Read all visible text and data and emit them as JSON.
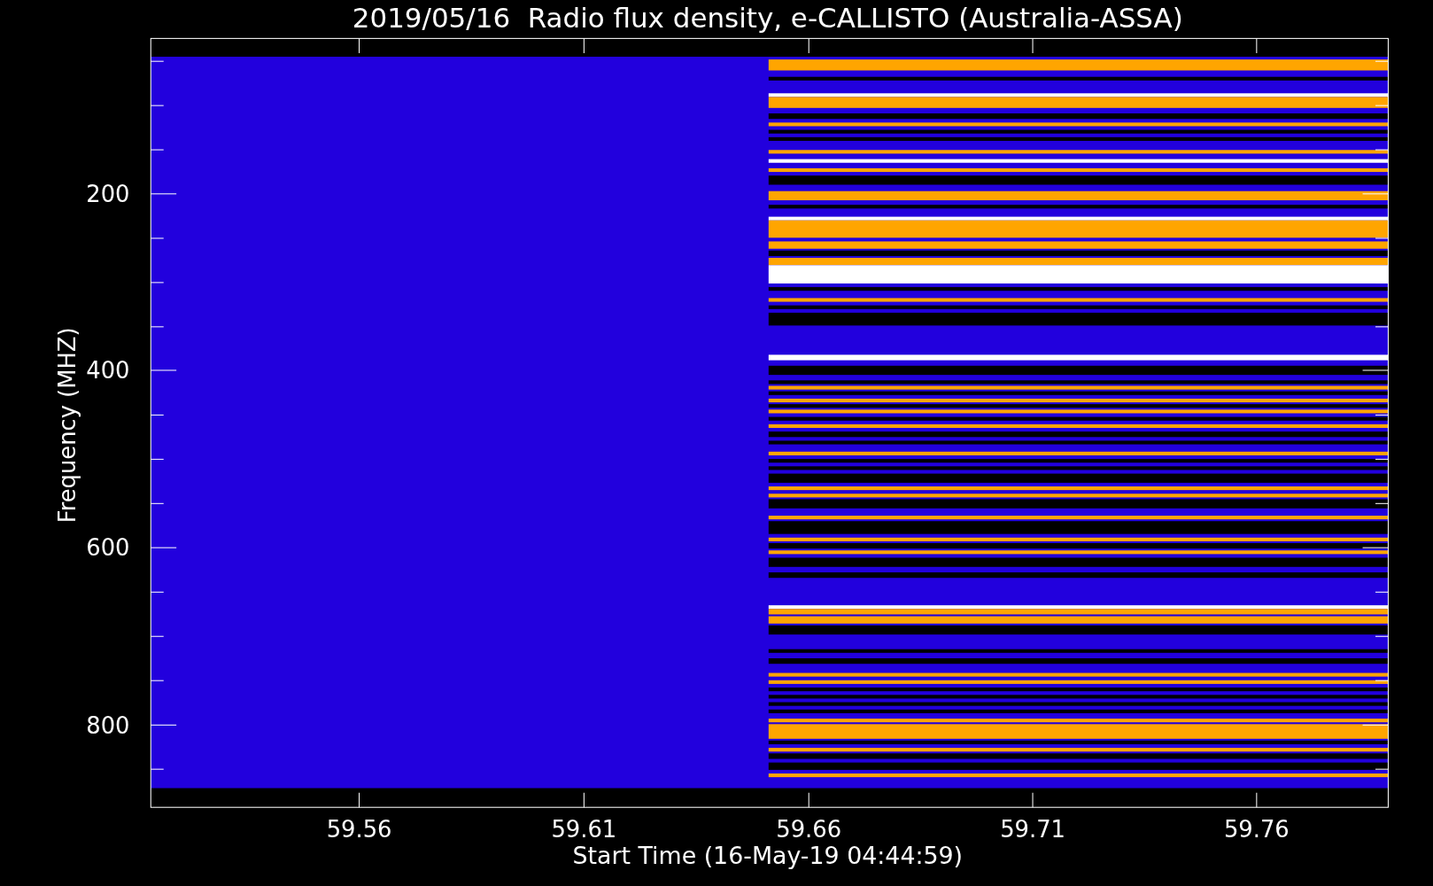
{
  "plot": {
    "title": "2019/05/16  Radio flux density, e-CALLISTO (Australia-ASSA)",
    "xlabel": "Start Time (16-May-19 04:44:59)",
    "ylabel": "Frequency (MHZ)",
    "xticks": [
      "59.56",
      "59.61",
      "59.66",
      "59.71",
      "59.76"
    ],
    "yticks": [
      "200",
      "400",
      "600",
      "800"
    ]
  }
}
